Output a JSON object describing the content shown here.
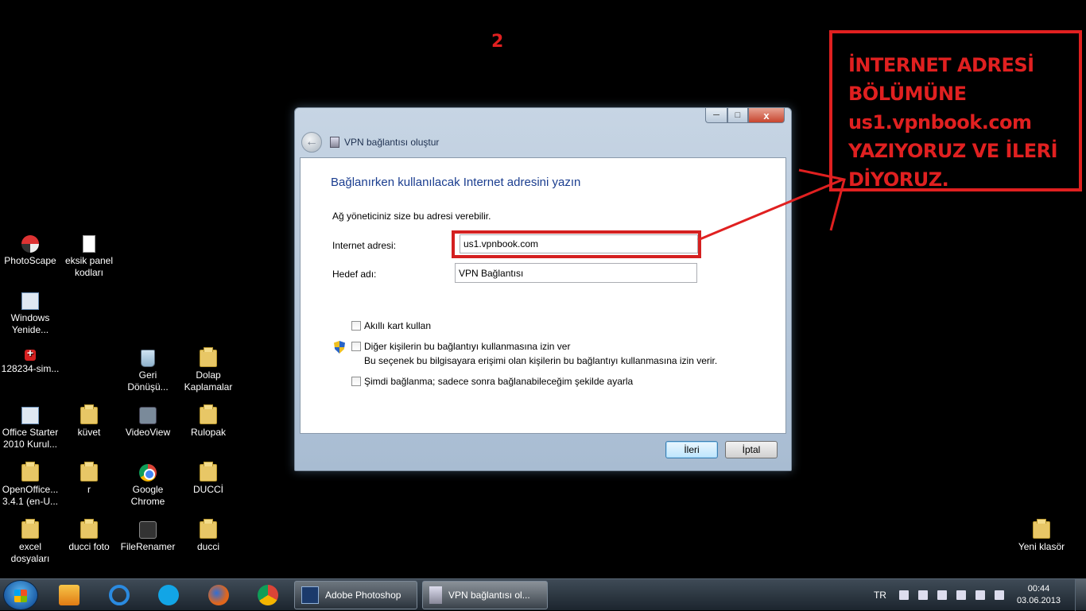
{
  "annotation": {
    "step_number": "2",
    "instruction": "İNTERNET ADRESİ\nBÖLÜMÜNE\nus1.vpnbook.com\nYAZIYORUZ VE İLERİ\nDİYORUZ."
  },
  "desktop_icons": [
    {
      "label": "PhotoScape",
      "icon": "photoscape-icon"
    },
    {
      "label": "eksik panel kodları",
      "icon": "text-document-icon"
    },
    {
      "label": "Windows Yenide...",
      "icon": "windows-program-icon"
    },
    {
      "label": "128234-sim...",
      "icon": "red-cross-icon"
    },
    {
      "label": "Geri Dönüşü...",
      "icon": "recycle-bin-icon"
    },
    {
      "label": "Dolap Kaplamalar",
      "icon": "folder-icon"
    },
    {
      "label": "Office Starter 2010 Kurul...",
      "icon": "office-installer-icon"
    },
    {
      "label": "küvet",
      "icon": "folder-icon"
    },
    {
      "label": "VideoView",
      "icon": "video-app-icon"
    },
    {
      "label": "Rulopak",
      "icon": "folder-icon"
    },
    {
      "label": "OpenOffice... 3.4.1 (en-U...",
      "icon": "folder-icon"
    },
    {
      "label": "r",
      "icon": "folder-icon"
    },
    {
      "label": "Google Chrome",
      "icon": "chrome-icon"
    },
    {
      "label": "DUCCİ",
      "icon": "folder-icon"
    },
    {
      "label": "excel dosyaları",
      "icon": "folder-icon"
    },
    {
      "label": "ducci foto",
      "icon": "folder-icon"
    },
    {
      "label": "FileRenamer",
      "icon": "file-renamer-icon"
    },
    {
      "label": "ducci",
      "icon": "folder-icon"
    },
    {
      "label": "Yeni klasör",
      "icon": "folder-icon"
    }
  ],
  "dialog": {
    "window_title": "VPN bağlantısı oluştur",
    "controls": {
      "minimize": "─",
      "maximize": "□",
      "close": "x"
    },
    "back_arrow": "←",
    "heading": "Bağlanırken kullanılacak Internet adresini yazın",
    "subtext": "Ağ yöneticiniz size bu adresi verebilir.",
    "address_label": "Internet adresi:",
    "address_value": "us1.vpnbook.com",
    "destination_label": "Hedef adı:",
    "destination_value": "VPN Bağlantısı",
    "smart_card_label": "Akıllı kart kullan",
    "smart_card_checked": false,
    "allow_others_label": "Diğer kişilerin bu bağlantıyı kullanmasına izin ver",
    "allow_others_checked": false,
    "allow_others_desc": "Bu seçenek bu bilgisayara erişimi olan kişilerin bu bağlantıyı kullanmasına izin verir.",
    "connect_later_label": "Şimdi bağlanma; sadece sonra bağlanabileceğim şekilde ayarla",
    "connect_later_checked": false,
    "next_button": "İleri",
    "cancel_button": "İptal"
  },
  "taskbar": {
    "pinned": [
      "media-player-icon",
      "internet-explorer-icon",
      "skype-icon",
      "firefox-icon",
      "chrome-icon"
    ],
    "tasks": [
      {
        "label": "Adobe Photoshop",
        "icon": "photoshop-icon"
      },
      {
        "label": "VPN bağlantısı ol...",
        "icon": "vpn-icon"
      }
    ],
    "language": "TR",
    "time": "00:44",
    "date": "03.06.2013"
  },
  "colors": {
    "annotation_red": "#e02020",
    "heading_blue": "#1a3d8f"
  }
}
